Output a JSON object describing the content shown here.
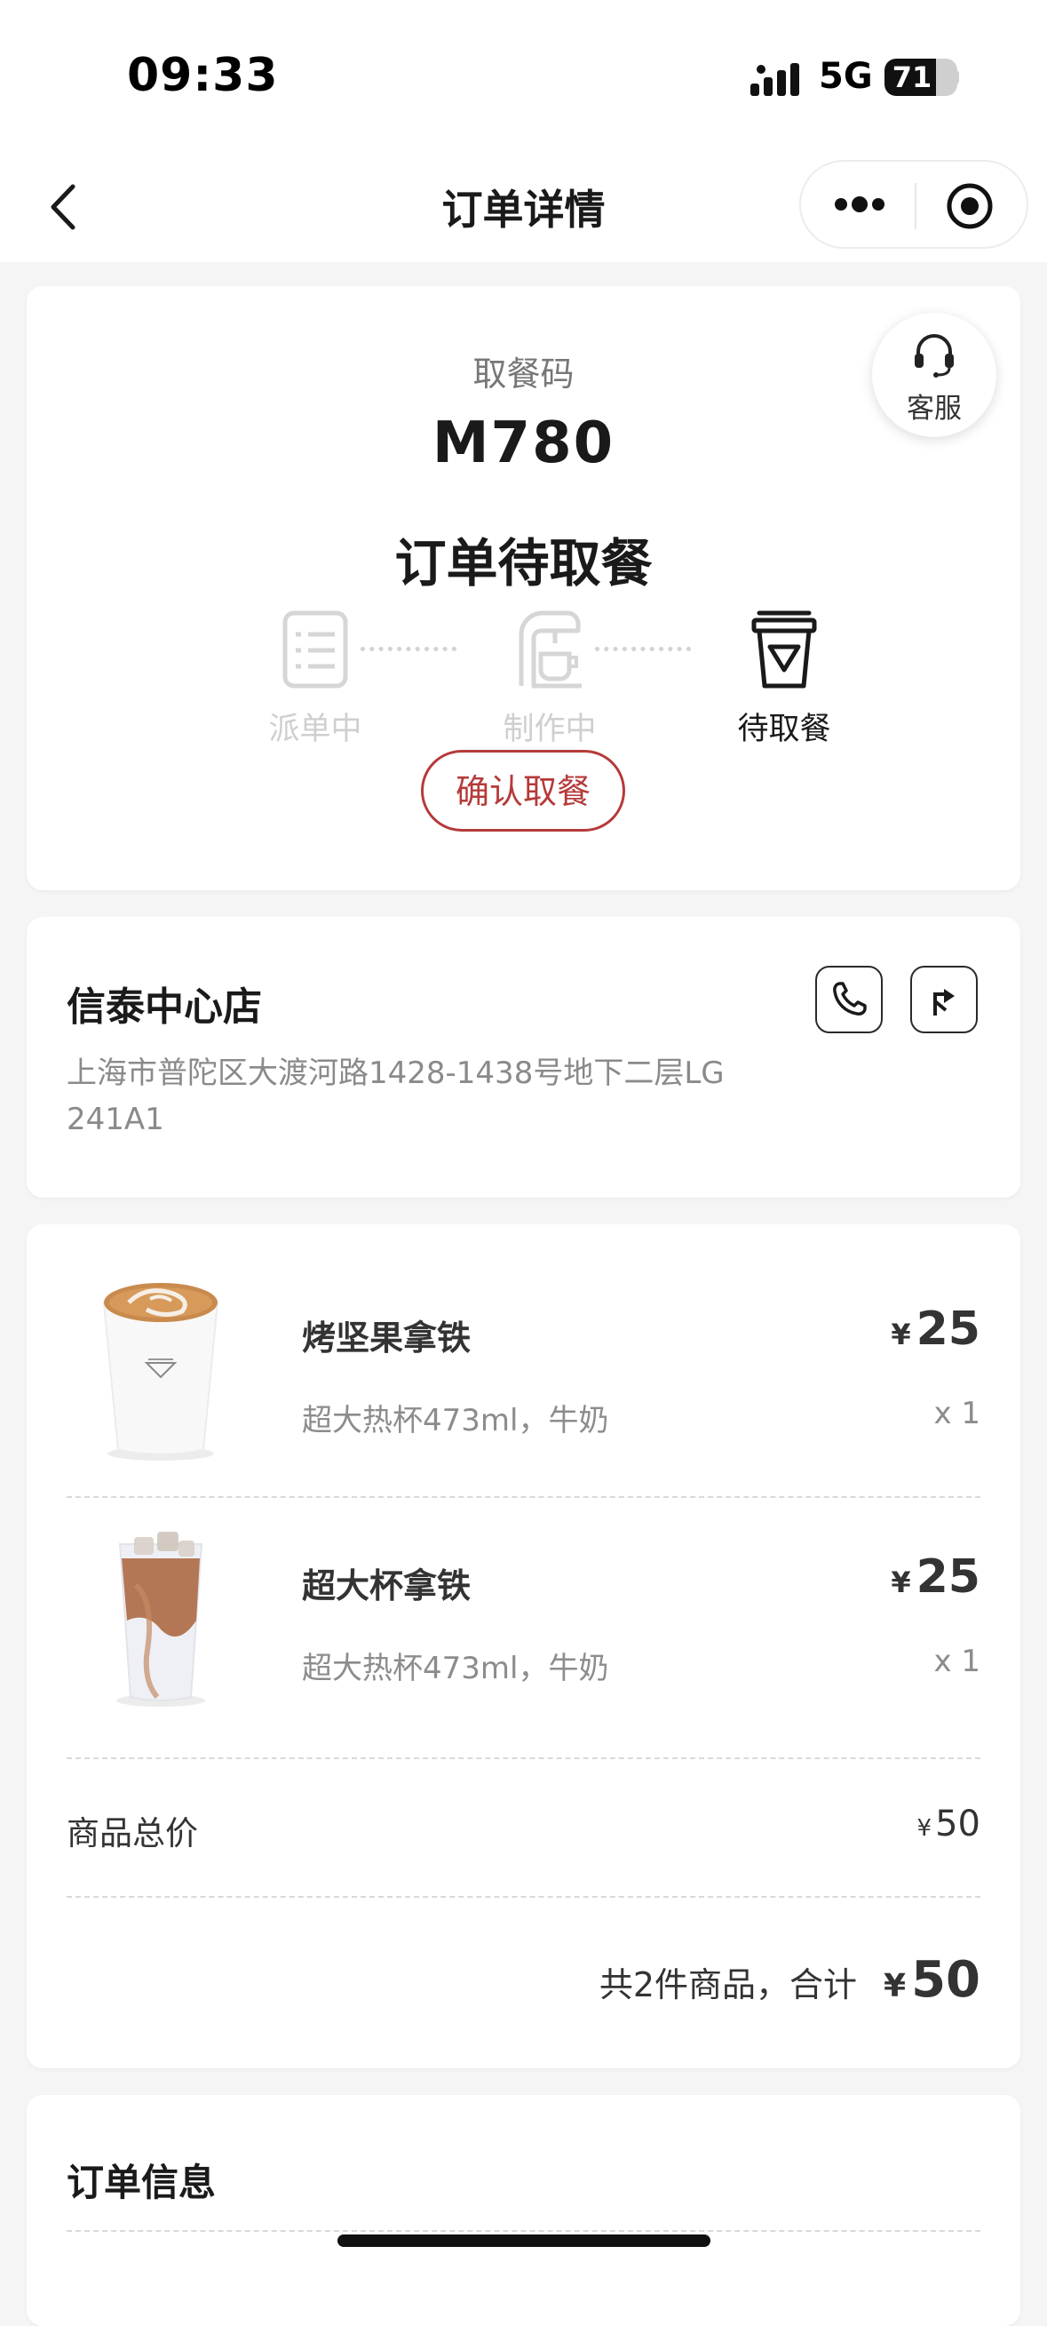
{
  "status_bar": {
    "time": "09:33",
    "network": "5G",
    "battery_level": "71",
    "battery_percent": 71,
    "signal_icon": "cellular-signal-icon"
  },
  "nav": {
    "title": "订单详情",
    "back_icon": "chevron-left-icon",
    "more_icon": "more-dots-icon",
    "close_icon": "target-circle-icon"
  },
  "pickup": {
    "code_label": "取餐码",
    "code": "M780",
    "status_title": "订单待取餐",
    "service_label": "客服",
    "service_icon": "headset-icon",
    "steps": [
      {
        "label": "派单中",
        "icon": "list-icon",
        "active": false
      },
      {
        "label": "制作中",
        "icon": "coffee-machine-icon",
        "active": false
      },
      {
        "label": "待取餐",
        "icon": "cup-icon",
        "active": true
      }
    ],
    "confirm_label": "确认取餐",
    "accent_color": "#b53a3a"
  },
  "store": {
    "name": "信泰中心店",
    "address": "上海市普陀区大渡河路1428-1438号地下二层LG 241A1",
    "phone_icon": "phone-icon",
    "directions_icon": "directions-icon"
  },
  "items": [
    {
      "name": "烤坚果拿铁",
      "spec": "超大热杯473ml，牛奶",
      "currency": "¥",
      "price": "25",
      "qty": "x 1",
      "image": "hot-latte-cup-image"
    },
    {
      "name": "超大杯拿铁",
      "spec": "超大热杯473ml，牛奶",
      "currency": "¥",
      "price": "25",
      "qty": "x 1",
      "image": "iced-latte-cup-image"
    }
  ],
  "totals": {
    "subtotal_label": "商品总价",
    "subtotal_currency": "¥",
    "subtotal_value": "50",
    "summary_text": "共2件商品，合计",
    "total_currency": "¥",
    "total_value": "50"
  },
  "order_info": {
    "title": "订单信息"
  }
}
